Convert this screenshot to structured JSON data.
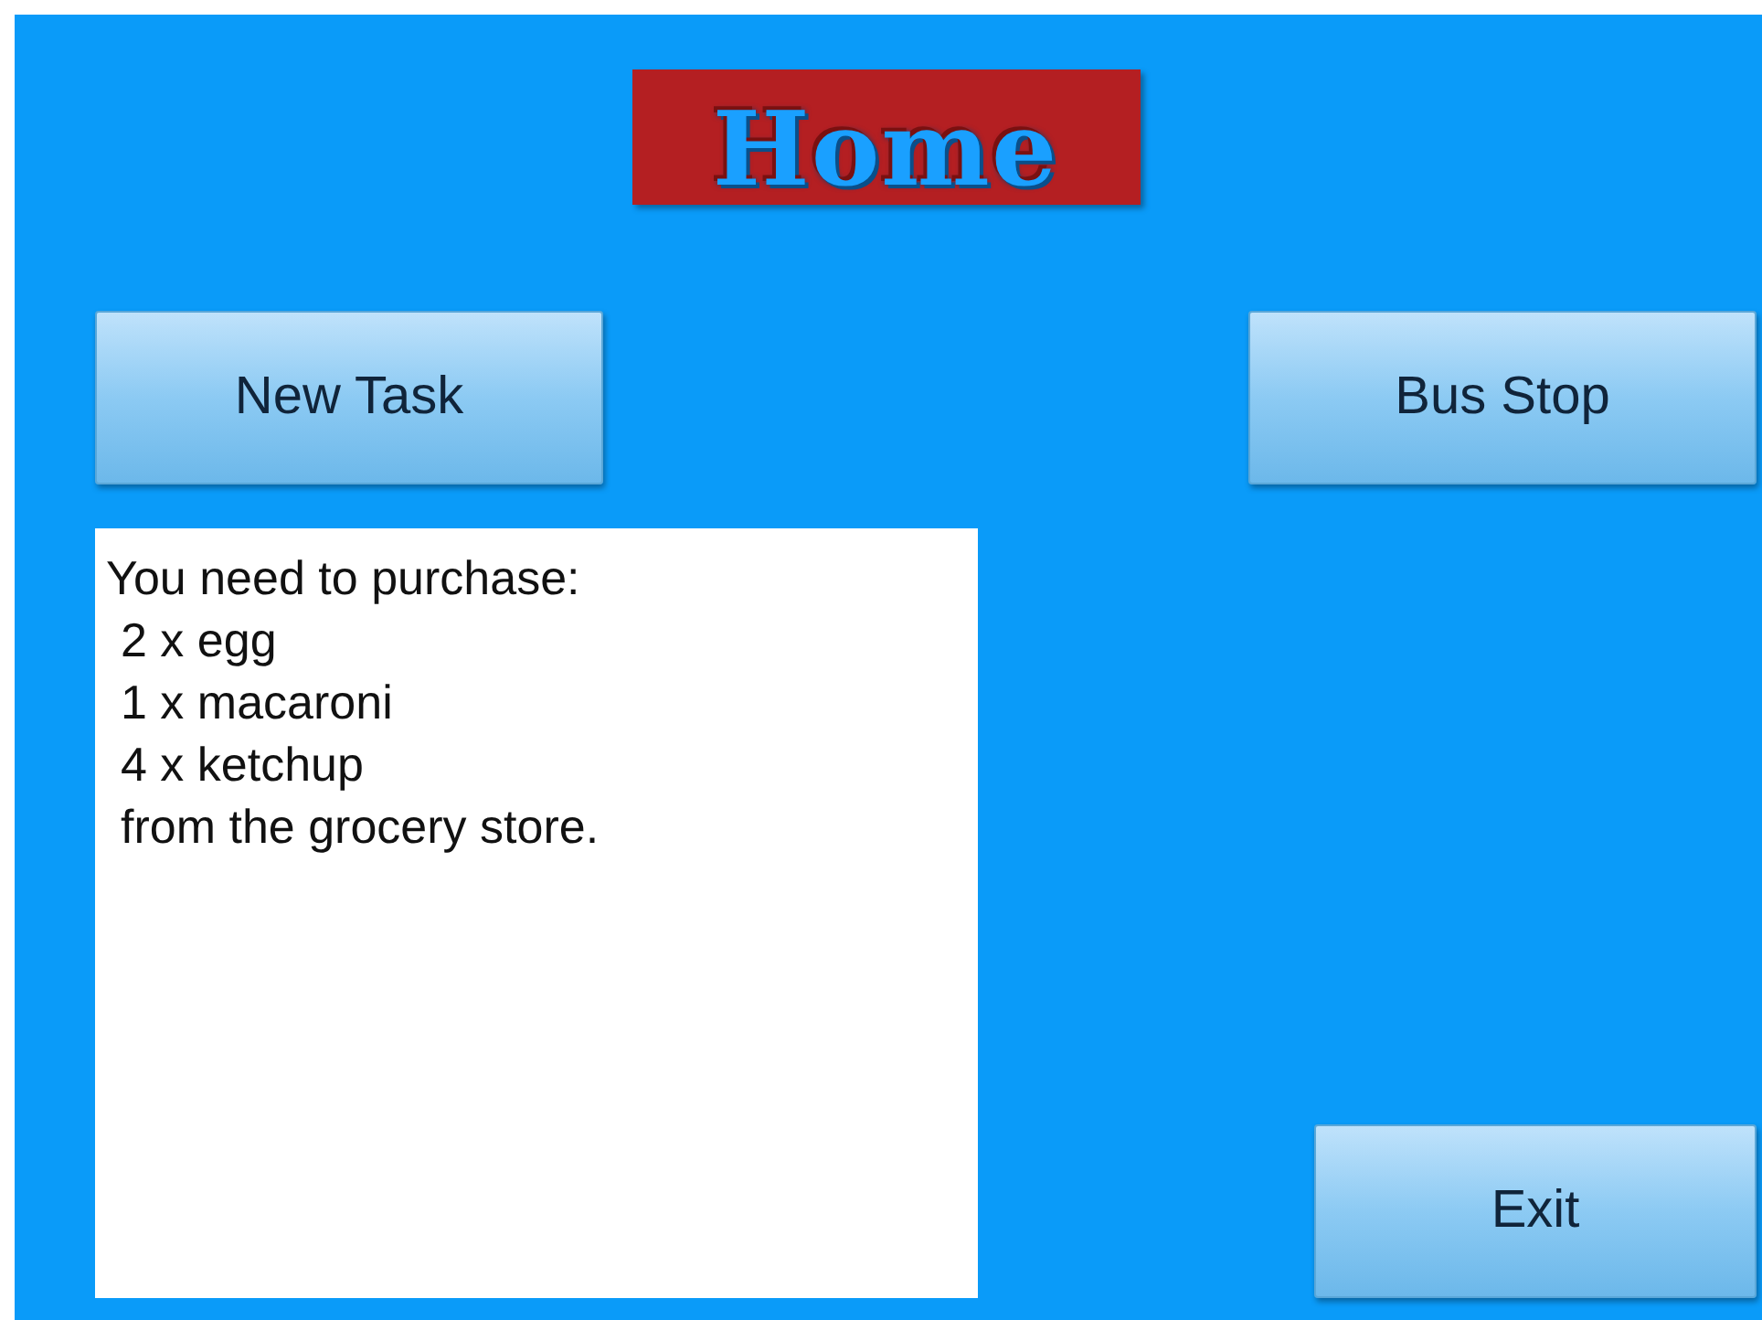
{
  "title": "Home",
  "top_buttons": [
    {
      "label": "New Task"
    },
    {
      "label": "Bus Stop"
    }
  ],
  "message": {
    "heading": "You need to purchase:",
    "items": [
      "2 x egg",
      "1 x macaroni",
      "4 x ketchup"
    ],
    "footer": "from the grocery store."
  },
  "exit_button": {
    "label": "Exit"
  }
}
